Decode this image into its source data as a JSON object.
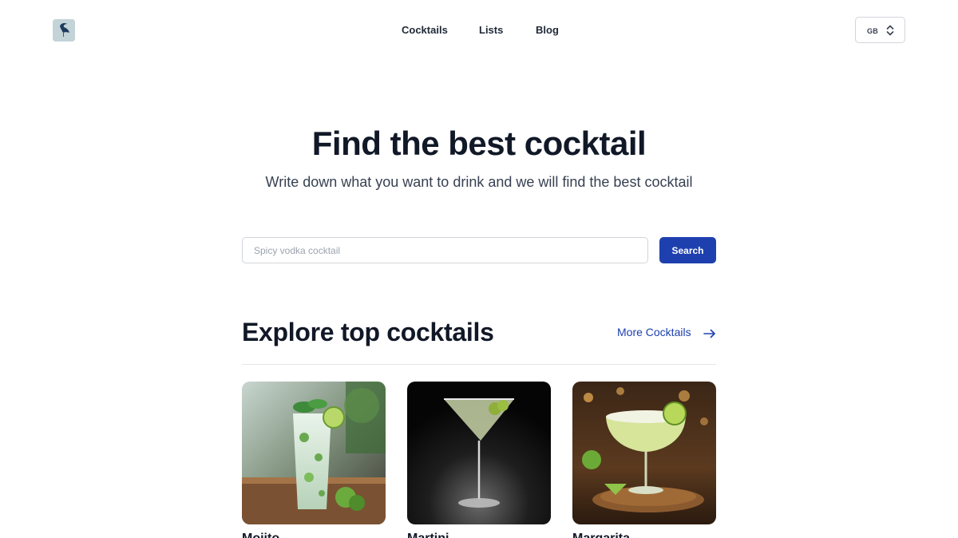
{
  "header": {
    "nav": [
      {
        "label": "Cocktails"
      },
      {
        "label": "Lists"
      },
      {
        "label": "Blog"
      }
    ],
    "language": {
      "code": "GB",
      "icon": "chevron-up-down-icon"
    },
    "logo_icon": "bird-logo-icon"
  },
  "hero": {
    "title": "Find the best cocktail",
    "subtitle": "Write down what you want to drink and we will find the best cocktail"
  },
  "search": {
    "placeholder": "Spicy vodka cocktail",
    "value": "",
    "button_label": "Search"
  },
  "explore": {
    "title": "Explore top cocktails",
    "more_label": "More Cocktails",
    "more_icon": "arrow-right-icon",
    "cards": [
      {
        "name": "Mojito",
        "image": "mojito-photo"
      },
      {
        "name": "Martini",
        "image": "martini-photo"
      },
      {
        "name": "Margarita",
        "image": "margarita-photo"
      }
    ]
  },
  "colors": {
    "accent": "#1e40af",
    "text": "#111827",
    "muted": "#374151",
    "border": "#d1d5db"
  }
}
